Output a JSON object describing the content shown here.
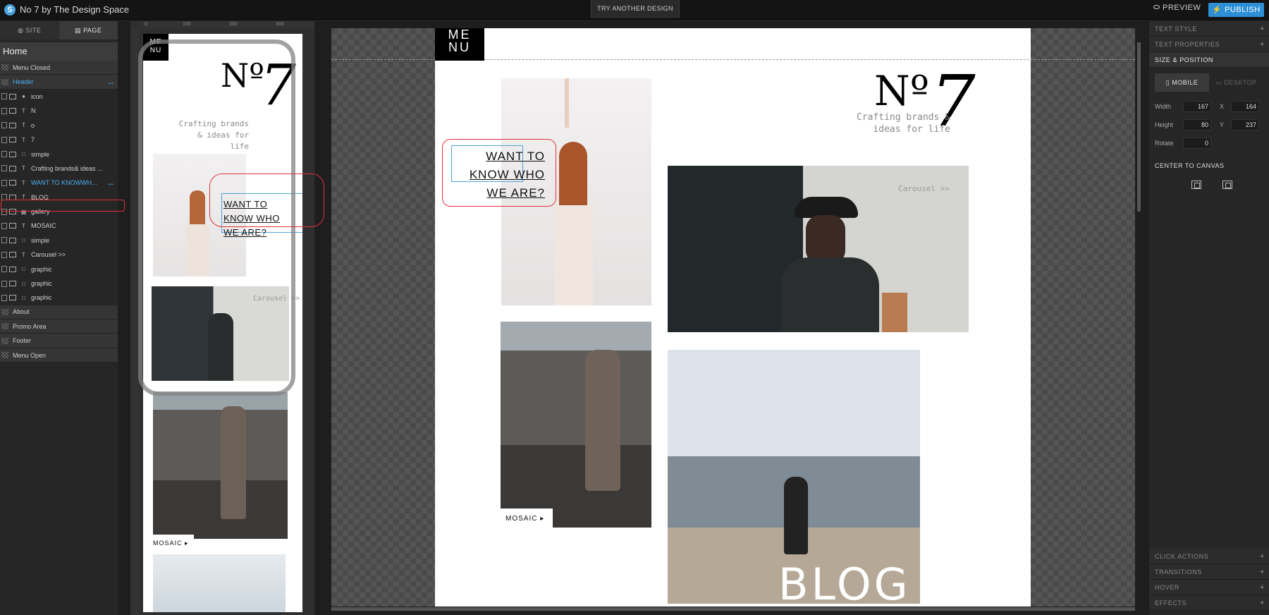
{
  "app": {
    "title": "No 7 by The Design Space"
  },
  "topbar": {
    "try_label": "TRY ANOTHER DESIGN",
    "preview_label": "PREVIEW",
    "publish_label": "PUBLISH"
  },
  "left": {
    "tabs": {
      "site": "SITE",
      "page": "PAGE"
    },
    "page_title": "Home",
    "layers": [
      {
        "label": "Menu Closed",
        "type": "section"
      },
      {
        "label": "Header",
        "type": "section"
      },
      {
        "label": "icon",
        "type": "item",
        "kind": "●"
      },
      {
        "label": "N",
        "type": "item",
        "kind": "T"
      },
      {
        "label": "o",
        "type": "item",
        "kind": "T"
      },
      {
        "label": "7",
        "type": "item",
        "kind": "T"
      },
      {
        "label": "simple",
        "type": "item",
        "kind": "□"
      },
      {
        "label": "Crafting brands& ideas ...",
        "type": "item",
        "kind": "T"
      },
      {
        "label": "WANT TO KNOWWH...",
        "type": "item",
        "kind": "T"
      },
      {
        "label": "BLOG",
        "type": "item",
        "kind": "T"
      },
      {
        "label": "gallery",
        "type": "item",
        "kind": "▦"
      },
      {
        "label": "MOSAIC",
        "type": "item",
        "kind": "T"
      },
      {
        "label": "simple",
        "type": "item",
        "kind": "□"
      },
      {
        "label": "Carousel >>",
        "type": "item",
        "kind": "T"
      },
      {
        "label": "graphic",
        "type": "item",
        "kind": "□"
      },
      {
        "label": "graphic",
        "type": "item",
        "kind": "□"
      },
      {
        "label": "graphic",
        "type": "item",
        "kind": "□"
      },
      {
        "label": "About",
        "type": "section"
      },
      {
        "label": "Promo Area",
        "type": "section"
      },
      {
        "label": "Footer",
        "type": "section"
      },
      {
        "label": "Menu Open",
        "type": "section"
      }
    ],
    "more_label": "...",
    "ruler_ticks": [
      "0",
      "100",
      "200",
      "300"
    ]
  },
  "mobile": {
    "menu": "ME NU",
    "no": "Nº",
    "seven": "7",
    "crafting": "Crafting brands & ideas for life",
    "want": "WANT TO KNOW WHO WE ARE?",
    "carousel": "Carousel >>",
    "mosaic": "MOSAIC ▸"
  },
  "canvas": {
    "menu": "ME NU",
    "no": "Nº",
    "seven": "7",
    "crafting": "Crafting brands & ideas for life",
    "want": "WANT TO KNOW WHO WE ARE?",
    "carousel": "Carousel >>",
    "mosaic": "MOSAIC ▸",
    "blog": "BLOG"
  },
  "right": {
    "text_style": "TEXT STYLE",
    "text_properties": "TEXT PROPERTIES",
    "size_position": "SIZE & POSITION",
    "mobile_tab": "MOBILE",
    "desktop_tab": "DESKTOP",
    "width_label": "Width",
    "width_val": "167",
    "x_label": "X",
    "x_val": "164",
    "height_label": "Height",
    "height_val": "80",
    "y_label": "Y",
    "y_val": "237",
    "rotate_label": "Rotate",
    "rotate_val": "0",
    "center_title": "CENTER TO CANVAS",
    "click_actions": "CLICK ACTIONS",
    "transitions": "TRANSITIONS",
    "hover": "HOVER",
    "effects": "EFFECTS"
  }
}
